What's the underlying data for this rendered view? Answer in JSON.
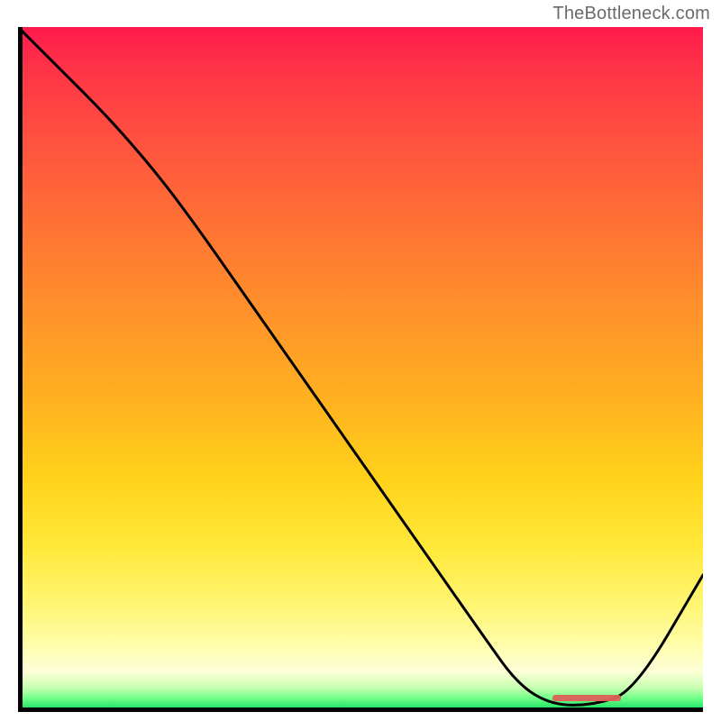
{
  "watermark": "TheBottleneck.com",
  "colors": {
    "gradient_top": "#ff1a4d",
    "gradient_mid": "#ffd21a",
    "gradient_bottom": "#18c85a",
    "axis": "#000000",
    "curve": "#000000",
    "marker": "#e0605a"
  },
  "chart_data": {
    "type": "line",
    "title": "",
    "xlabel": "",
    "ylabel": "",
    "xlim": [
      0,
      100
    ],
    "ylim": [
      0,
      100
    ],
    "grid": false,
    "legend": false,
    "series": [
      {
        "name": "curve",
        "x": [
          0,
          6,
          13,
          20,
          26,
          33,
          40,
          47,
          54,
          61,
          68,
          73,
          78,
          84,
          90,
          100
        ],
        "values": [
          100,
          94,
          87,
          79,
          71,
          61,
          51,
          41,
          31,
          21,
          11,
          4,
          1,
          1,
          3,
          20
        ]
      }
    ],
    "marker": {
      "x_start": 78,
      "x_end": 88,
      "y": 2
    },
    "notes": "Background is a vertical red→orange→yellow→green gradient. Curve dips to a trough near x≈80–85, flat segment along bottom is highlighted by a small red marker."
  }
}
